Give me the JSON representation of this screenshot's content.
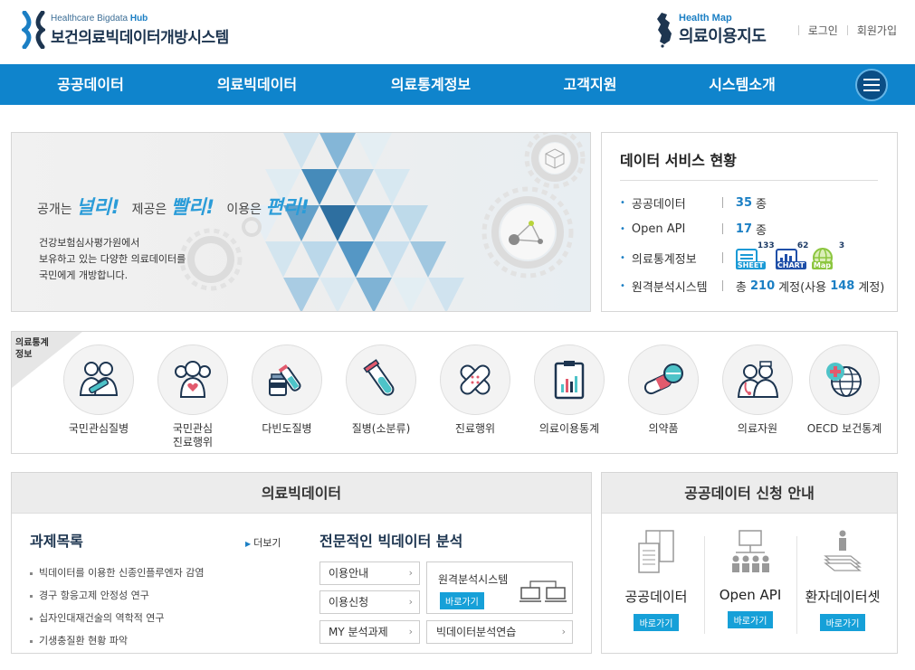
{
  "header": {
    "logo_sub_prefix": "Healthcare Bigdata ",
    "logo_sub_strong": "Hub",
    "logo_main": "보건의료빅데이터개방시스템",
    "map_sub": "Health Map",
    "map_main": "의료이용지도",
    "login": "로그인",
    "signup": "회원가입"
  },
  "nav": {
    "items": [
      "공공데이터",
      "의료빅데이터",
      "의료통계정보",
      "고객지원",
      "시스템소개"
    ],
    "menu_icon": "hamburger-icon"
  },
  "banner": {
    "slogan_1": "공개는",
    "slogan_1_hl": "널리!",
    "slogan_2": "제공은",
    "slogan_2_hl": "빨리!",
    "slogan_3": "이용은",
    "slogan_3_hl": "편리!",
    "desc_1": "건강보험심사평가원에서",
    "desc_2": "보유하고 있는 다양한 의료데이터를",
    "desc_3": "국민에게 개방합니다."
  },
  "service": {
    "title": "데이터 서비스 현황",
    "rows": [
      {
        "label": "공공데이터",
        "num": "35",
        "unit": "종"
      },
      {
        "label": "Open API",
        "num": "17",
        "unit": "종"
      },
      {
        "label": "의료통계정보"
      },
      {
        "label": "원격분석시스템",
        "prefix": "총",
        "num": "210",
        "mid": "계정(사용",
        "num2": "148",
        "unit": "계정)"
      }
    ],
    "stat_icons": [
      {
        "name": "sheet-icon",
        "tag": "SHEET",
        "count": "133",
        "color": "#1a9ad6"
      },
      {
        "name": "chart-icon",
        "tag": "CHART",
        "count": "62",
        "color": "#1f4fa8"
      },
      {
        "name": "map-icon",
        "tag": "Map",
        "count": "3",
        "color": "#8cc63f"
      }
    ]
  },
  "stats": {
    "label_1": "의료통계",
    "label_2": "정보",
    "items": [
      {
        "label": "국민관심질병",
        "icon": "doctors-icon"
      },
      {
        "label": "국민관심\n진료행위",
        "icon": "people-heart-icon"
      },
      {
        "label": "다빈도질병",
        "icon": "medicine-bottle-icon"
      },
      {
        "label": "질병(소분류)",
        "icon": "test-tube-icon"
      },
      {
        "label": "진료행위",
        "icon": "bandage-icon"
      },
      {
        "label": "의료이용통계",
        "icon": "clipboard-chart-icon"
      },
      {
        "label": "의약품",
        "icon": "pill-icon"
      },
      {
        "label": "의료자원",
        "icon": "doctor-nurse-icon"
      },
      {
        "label": "OECD 보건통계",
        "icon": "globe-plus-icon"
      }
    ]
  },
  "bigdata": {
    "title": "의료빅데이터",
    "tasks_title": "과제목록",
    "more": "더보기",
    "tasks": [
      "빅데이터를 이용한 신종인플루엔자 감염",
      "경구 항응고제 안정성 연구",
      "십자인대재건술의 역학적 연구",
      "기생충질환 현황 파악"
    ],
    "analysis_title": "전문적인 빅데이터 분석",
    "buttons": [
      "이용안내",
      "이용신청",
      "MY 분석과제"
    ],
    "remote_title": "원격분석시스템",
    "remote_go": "바로가기",
    "practice": "빅데이터분석연습"
  },
  "apply": {
    "title": "공공데이터 신청 안내",
    "cols": [
      {
        "label": "공공데이터",
        "go": "바로가기",
        "icon": "document-icon"
      },
      {
        "label": "Open API",
        "go": "바로가기",
        "icon": "network-icon"
      },
      {
        "label": "환자데이터셋",
        "go": "바로가기",
        "icon": "dataset-icon"
      }
    ]
  }
}
